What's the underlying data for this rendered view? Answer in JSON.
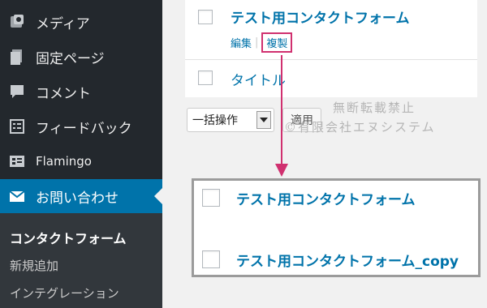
{
  "sidebar": {
    "items": [
      {
        "label": "メディア",
        "icon": "media-icon"
      },
      {
        "label": "固定ページ",
        "icon": "page-icon"
      },
      {
        "label": "コメント",
        "icon": "comment-icon"
      },
      {
        "label": "フィードバック",
        "icon": "feedback-icon"
      },
      {
        "label": "Flamingo",
        "icon": "flamingo-icon"
      },
      {
        "label": "お問い合わせ",
        "icon": "mail-icon"
      }
    ],
    "submenu": [
      {
        "label": "コンタクトフォーム"
      },
      {
        "label": "新規追加"
      },
      {
        "label": "インテグレーション"
      }
    ]
  },
  "list": {
    "rows": [
      {
        "title": "テスト用コンタクトフォーム"
      },
      {
        "title": "タイトル"
      }
    ],
    "row_actions": {
      "edit": "編集",
      "separator": "|",
      "duplicate": "複製"
    }
  },
  "bulk": {
    "select_value": "一括操作",
    "apply_label": "適用"
  },
  "watermark": {
    "line1": "無断転載禁止",
    "line2": "©有限会社エヌシステム"
  },
  "result": {
    "rows": [
      {
        "title": "テスト用コンタクトフォーム"
      },
      {
        "title": "テスト用コンタクトフォーム_copy"
      }
    ]
  },
  "colors": {
    "accent": "#0073aa",
    "highlight": "#d0306f",
    "sidebar_bg": "#23282d"
  }
}
